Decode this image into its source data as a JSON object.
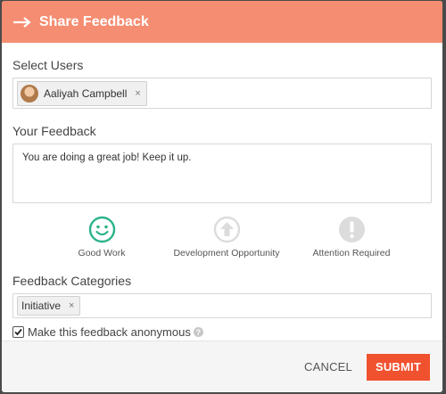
{
  "header": {
    "title": "Share Feedback"
  },
  "select_users": {
    "label": "Select Users",
    "chips": [
      {
        "name": "Aaliyah Campbell",
        "remove": "×"
      }
    ]
  },
  "feedback": {
    "label": "Your Feedback",
    "value": "You are doing a great job! Keep it up."
  },
  "reactions": [
    {
      "label": "Good Work",
      "icon": "smiley-icon",
      "color": "#2bb38a",
      "selected": true
    },
    {
      "label": "Development Opportunity",
      "icon": "arrow-up-circle-icon",
      "color": "#dcdcdc",
      "selected": false
    },
    {
      "label": "Attention Required",
      "icon": "exclamation-circle-icon",
      "color": "#dcdcdc",
      "selected": false
    }
  ],
  "categories": {
    "label": "Feedback Categories",
    "chips": [
      {
        "name": "Initiative",
        "remove": "×"
      }
    ]
  },
  "anonymous": {
    "label": "Make this feedback anonymous",
    "checked": true,
    "help": "?"
  },
  "footer": {
    "cancel_label": "CANCEL",
    "submit_label": "SUBMIT"
  },
  "colors": {
    "header": "#f58d72",
    "submit": "#f0512f",
    "good_work": "#2bb38a"
  }
}
